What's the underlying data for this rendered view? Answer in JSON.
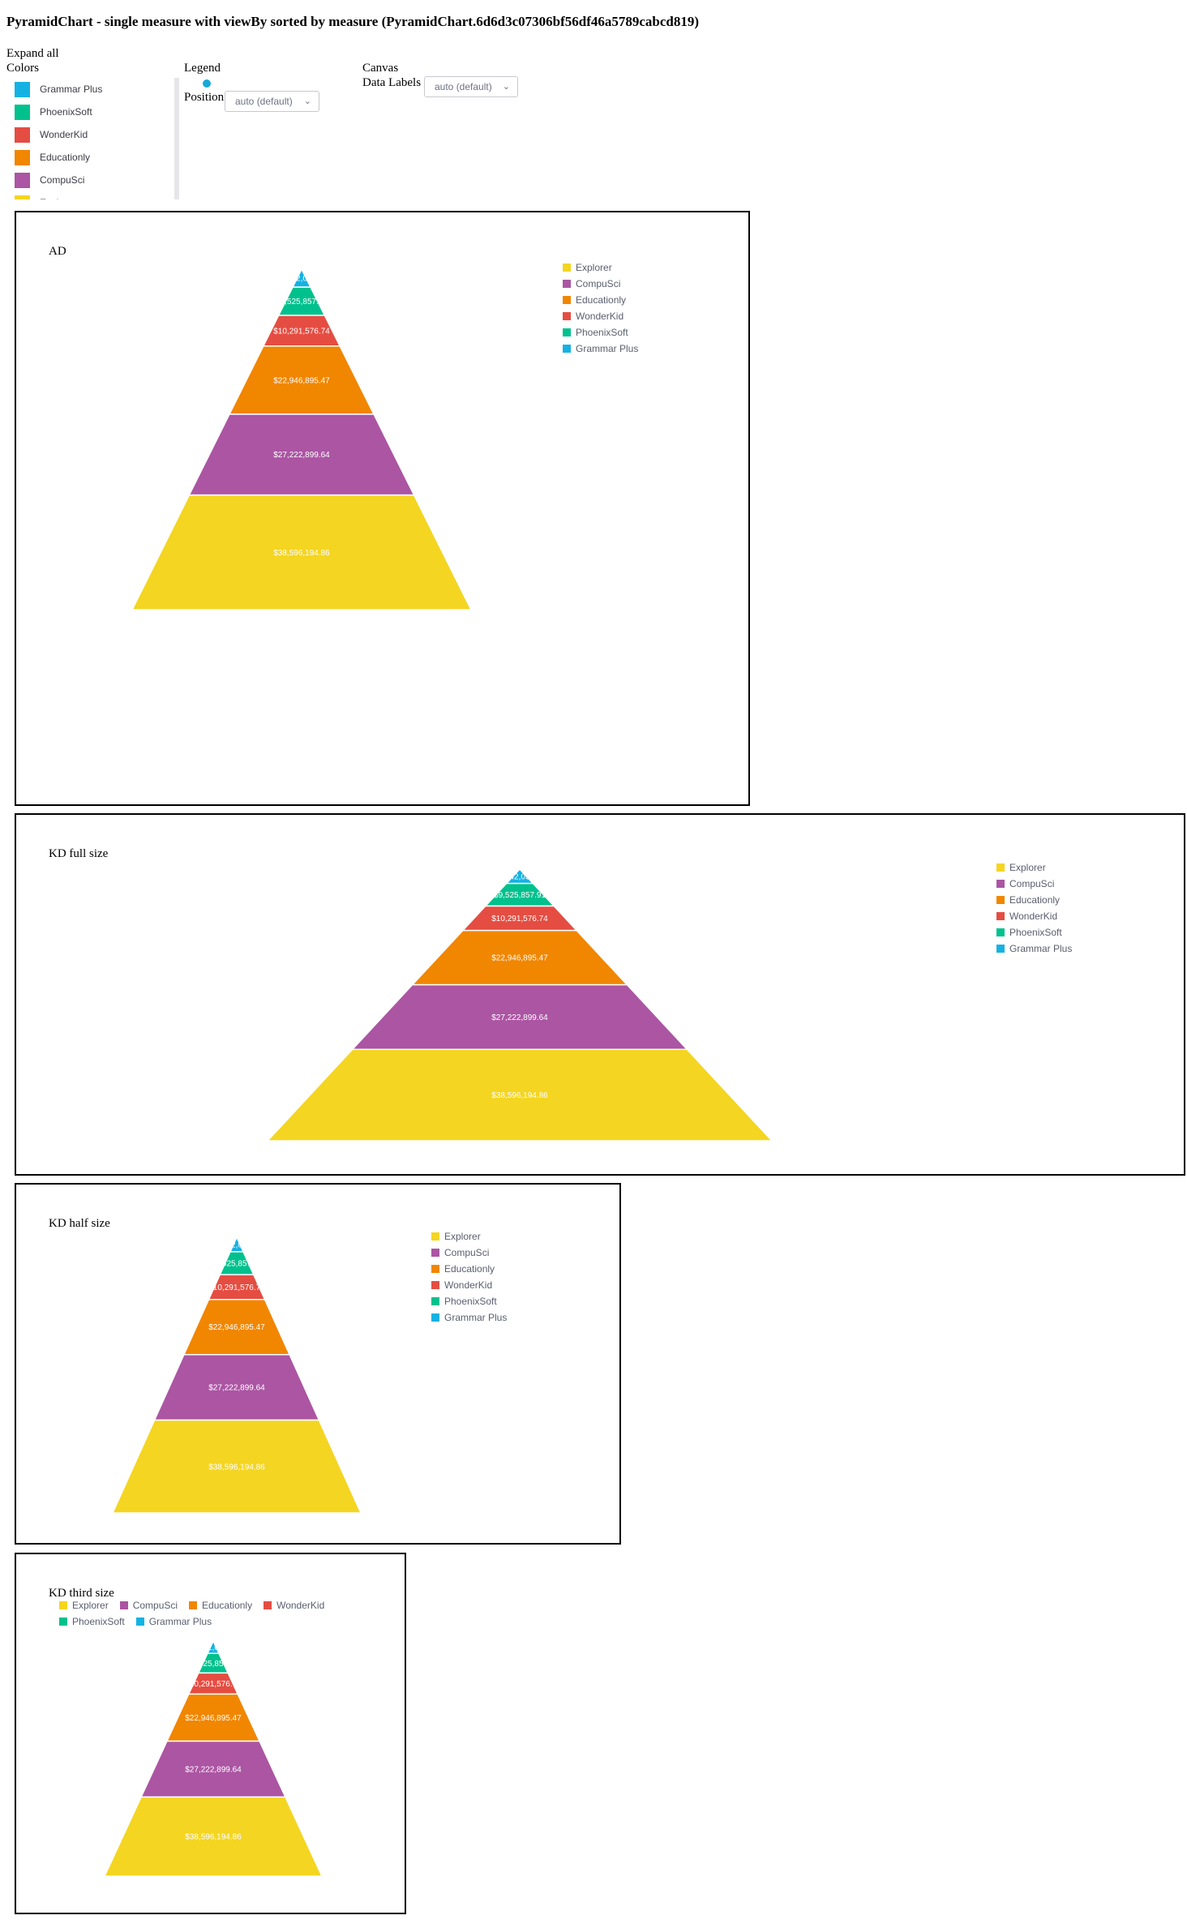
{
  "page_title": "PyramidChart - single measure with viewBy sorted by measure (PyramidChart.6d6d3c07306bf56df46a5789cabcd819)",
  "controls": {
    "expand_all": "Expand all",
    "colors_label": "Colors",
    "legend_label": "Legend",
    "position_label": "Position",
    "position_value": "auto (default)",
    "canvas_label": "Canvas",
    "data_labels_label": "Data Labels",
    "data_labels_value": "auto (default)",
    "chevron": "⌄",
    "color_items": [
      {
        "name": "Grammar Plus",
        "color": "#14b2e2"
      },
      {
        "name": "PhoenixSoft",
        "color": "#00c18d"
      },
      {
        "name": "WonderKid",
        "color": "#e54d42"
      },
      {
        "name": "Educationly",
        "color": "#f18600"
      },
      {
        "name": "CompuSci",
        "color": "#ab55a3"
      },
      {
        "name": "Explorer",
        "color": "#f4d521"
      }
    ]
  },
  "panels": [
    {
      "title": "AD"
    },
    {
      "title": "KD full size"
    },
    {
      "title": "KD half size"
    },
    {
      "title": "KD third size"
    }
  ],
  "chart_data": {
    "type": "pyramid",
    "categories": [
      "Grammar Plus",
      "PhoenixSoft",
      "WonderKid",
      "Educationly",
      "CompuSci",
      "Explorer"
    ],
    "values": [
      6042031.37,
      9525857.91,
      10291576.74,
      22946895.47,
      27222899.64,
      38596194.86
    ],
    "labels": [
      "$6,042,031.37",
      "$9,525,857.91",
      "$10,291,576.74",
      "$22,946,895.47",
      "$27,222,899.64",
      "$38,596,194.86"
    ],
    "colors": [
      "#14b2e2",
      "#00c18d",
      "#e54d42",
      "#f18600",
      "#ab55a3",
      "#f4d521"
    ],
    "legend_order": [
      "Explorer",
      "CompuSci",
      "Educationly",
      "WonderKid",
      "PhoenixSoft",
      "Grammar Plus"
    ],
    "legend_colors": [
      "#f4d521",
      "#ab55a3",
      "#f18600",
      "#e54d42",
      "#00c18d",
      "#14b2e2"
    ]
  }
}
